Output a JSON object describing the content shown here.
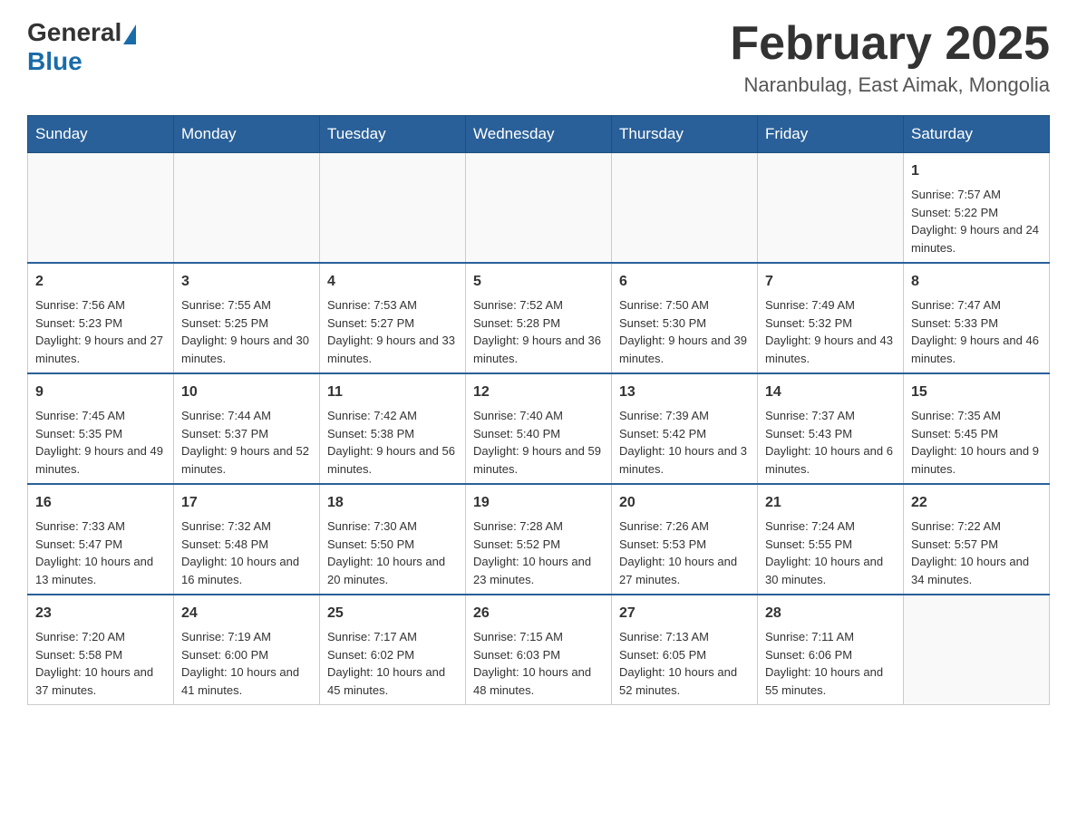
{
  "header": {
    "logo_general": "General",
    "logo_blue": "Blue",
    "month_year": "February 2025",
    "location": "Naranbulag, East Aimak, Mongolia"
  },
  "days_of_week": [
    "Sunday",
    "Monday",
    "Tuesday",
    "Wednesday",
    "Thursday",
    "Friday",
    "Saturday"
  ],
  "weeks": [
    [
      {
        "day": "",
        "info": ""
      },
      {
        "day": "",
        "info": ""
      },
      {
        "day": "",
        "info": ""
      },
      {
        "day": "",
        "info": ""
      },
      {
        "day": "",
        "info": ""
      },
      {
        "day": "",
        "info": ""
      },
      {
        "day": "1",
        "info": "Sunrise: 7:57 AM\nSunset: 5:22 PM\nDaylight: 9 hours and 24 minutes."
      }
    ],
    [
      {
        "day": "2",
        "info": "Sunrise: 7:56 AM\nSunset: 5:23 PM\nDaylight: 9 hours and 27 minutes."
      },
      {
        "day": "3",
        "info": "Sunrise: 7:55 AM\nSunset: 5:25 PM\nDaylight: 9 hours and 30 minutes."
      },
      {
        "day": "4",
        "info": "Sunrise: 7:53 AM\nSunset: 5:27 PM\nDaylight: 9 hours and 33 minutes."
      },
      {
        "day": "5",
        "info": "Sunrise: 7:52 AM\nSunset: 5:28 PM\nDaylight: 9 hours and 36 minutes."
      },
      {
        "day": "6",
        "info": "Sunrise: 7:50 AM\nSunset: 5:30 PM\nDaylight: 9 hours and 39 minutes."
      },
      {
        "day": "7",
        "info": "Sunrise: 7:49 AM\nSunset: 5:32 PM\nDaylight: 9 hours and 43 minutes."
      },
      {
        "day": "8",
        "info": "Sunrise: 7:47 AM\nSunset: 5:33 PM\nDaylight: 9 hours and 46 minutes."
      }
    ],
    [
      {
        "day": "9",
        "info": "Sunrise: 7:45 AM\nSunset: 5:35 PM\nDaylight: 9 hours and 49 minutes."
      },
      {
        "day": "10",
        "info": "Sunrise: 7:44 AM\nSunset: 5:37 PM\nDaylight: 9 hours and 52 minutes."
      },
      {
        "day": "11",
        "info": "Sunrise: 7:42 AM\nSunset: 5:38 PM\nDaylight: 9 hours and 56 minutes."
      },
      {
        "day": "12",
        "info": "Sunrise: 7:40 AM\nSunset: 5:40 PM\nDaylight: 9 hours and 59 minutes."
      },
      {
        "day": "13",
        "info": "Sunrise: 7:39 AM\nSunset: 5:42 PM\nDaylight: 10 hours and 3 minutes."
      },
      {
        "day": "14",
        "info": "Sunrise: 7:37 AM\nSunset: 5:43 PM\nDaylight: 10 hours and 6 minutes."
      },
      {
        "day": "15",
        "info": "Sunrise: 7:35 AM\nSunset: 5:45 PM\nDaylight: 10 hours and 9 minutes."
      }
    ],
    [
      {
        "day": "16",
        "info": "Sunrise: 7:33 AM\nSunset: 5:47 PM\nDaylight: 10 hours and 13 minutes."
      },
      {
        "day": "17",
        "info": "Sunrise: 7:32 AM\nSunset: 5:48 PM\nDaylight: 10 hours and 16 minutes."
      },
      {
        "day": "18",
        "info": "Sunrise: 7:30 AM\nSunset: 5:50 PM\nDaylight: 10 hours and 20 minutes."
      },
      {
        "day": "19",
        "info": "Sunrise: 7:28 AM\nSunset: 5:52 PM\nDaylight: 10 hours and 23 minutes."
      },
      {
        "day": "20",
        "info": "Sunrise: 7:26 AM\nSunset: 5:53 PM\nDaylight: 10 hours and 27 minutes."
      },
      {
        "day": "21",
        "info": "Sunrise: 7:24 AM\nSunset: 5:55 PM\nDaylight: 10 hours and 30 minutes."
      },
      {
        "day": "22",
        "info": "Sunrise: 7:22 AM\nSunset: 5:57 PM\nDaylight: 10 hours and 34 minutes."
      }
    ],
    [
      {
        "day": "23",
        "info": "Sunrise: 7:20 AM\nSunset: 5:58 PM\nDaylight: 10 hours and 37 minutes."
      },
      {
        "day": "24",
        "info": "Sunrise: 7:19 AM\nSunset: 6:00 PM\nDaylight: 10 hours and 41 minutes."
      },
      {
        "day": "25",
        "info": "Sunrise: 7:17 AM\nSunset: 6:02 PM\nDaylight: 10 hours and 45 minutes."
      },
      {
        "day": "26",
        "info": "Sunrise: 7:15 AM\nSunset: 6:03 PM\nDaylight: 10 hours and 48 minutes."
      },
      {
        "day": "27",
        "info": "Sunrise: 7:13 AM\nSunset: 6:05 PM\nDaylight: 10 hours and 52 minutes."
      },
      {
        "day": "28",
        "info": "Sunrise: 7:11 AM\nSunset: 6:06 PM\nDaylight: 10 hours and 55 minutes."
      },
      {
        "day": "",
        "info": ""
      }
    ]
  ]
}
